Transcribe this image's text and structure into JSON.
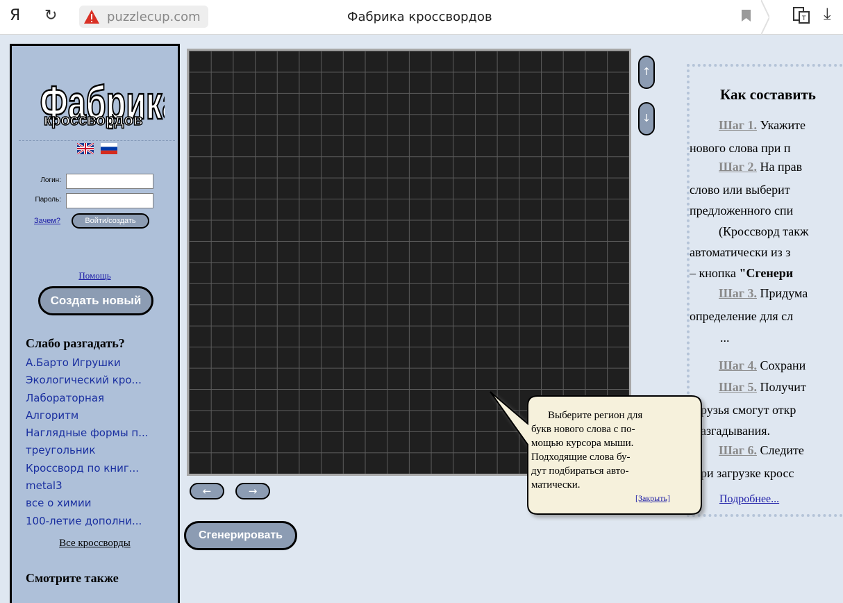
{
  "browser": {
    "ya_glyph": "Я",
    "reload_glyph": "↻",
    "domain": "puzzlecup.com",
    "tab_title": "Фабрика кроссвордов",
    "download_glyph": "⤓",
    "icons": [
      "yandex-logo-icon",
      "reload-icon",
      "warning-icon",
      "bookmark-icon",
      "extension-icon",
      "download-icon"
    ]
  },
  "sidebar": {
    "logo_line1": "Фабрика",
    "logo_line2": "кроссвордов",
    "login_label": "Логин:",
    "password_label": "Пароль:",
    "login_value": "",
    "password_value": "",
    "why_link": "Зачем?",
    "login_button": "Войти/создать",
    "help_link": "Помощь",
    "create_button": "Создать новый",
    "hard_title": "Слабо разгадать?",
    "puzzles": [
      "А.Барто Игрушки",
      "Экологический кро...",
      "Лабораторная",
      "Алгоритм",
      "Наглядные формы п...",
      "треугольник",
      "Кроссворд по книг...",
      "metal3",
      "все о химии",
      "100-летие дополни..."
    ],
    "all_link": "Все кроссворды",
    "see_also_title": "Смотрите также"
  },
  "grid": {
    "columns": 20,
    "rows": 20
  },
  "controls": {
    "up_arrow": "↑",
    "down_arrow": "↓",
    "left_arrow": "←",
    "right_arrow": "→",
    "generate_button": "Сгенерировать"
  },
  "howto": {
    "title": "Как составить",
    "step1": "Шаг 1.",
    "step1_text": " Укажите",
    "line2": "нового слова при п",
    "step2": "Шаг 2.",
    "step2_text": " На прав",
    "line4": "слово или выберит",
    "line5": "предложенного спи",
    "line6": "(Кроссворд такж",
    "line7": "автоматически из з",
    "line8_prefix": "– кнопка ",
    "line8_bold": "\"Сгенери",
    "step3": "Шаг 3.",
    "step3_text": " Придума",
    "line10": "определение для сл",
    "ellipsis": "...",
    "step4": "Шаг 4.",
    "step4_text": " Сохрани",
    "step5": "Шаг 5.",
    "step5_text": " Получит",
    "line13": "рузья смогут откр",
    "line14": "азгадывания.",
    "step6": "Шаг 6.",
    "step6_text": " Следите",
    "line16": "ри загрузке кросс",
    "more_link": "Подробнее..."
  },
  "tooltip": {
    "lines": [
      "Выберите регион для",
      "букв нового слова с по-",
      "мощью курсора мыши.",
      "Подходящие слова бу-",
      "дут подбираться авто-",
      "матически."
    ],
    "close_link": "[Закрыть]"
  }
}
